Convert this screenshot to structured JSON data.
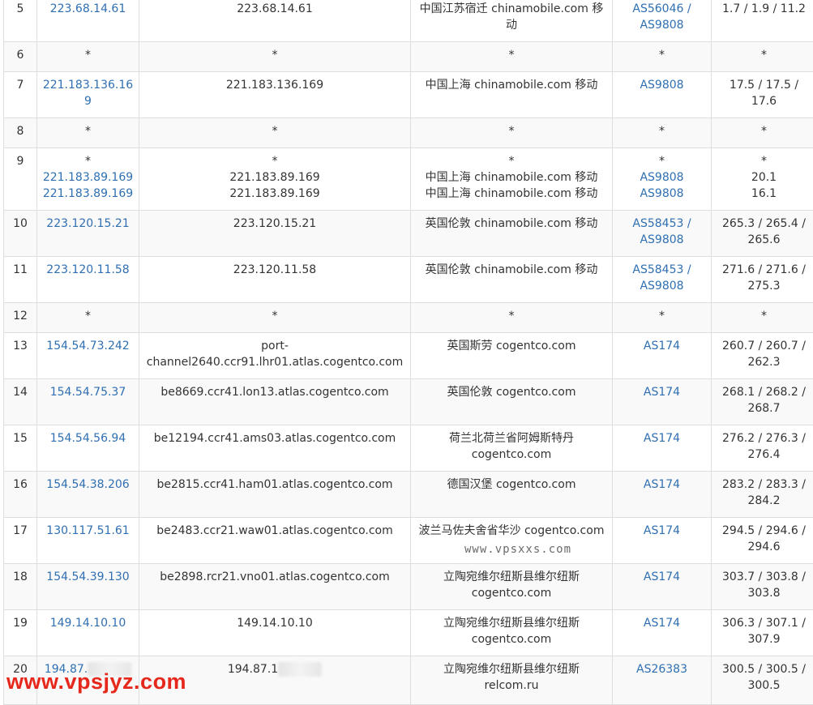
{
  "rows": [
    {
      "hop": "5",
      "ips": [
        "223.68.14.61"
      ],
      "hosts": [
        "223.68.14.61"
      ],
      "locations": [
        "中国江苏宿迁 chinamobile.com 移动"
      ],
      "as": [
        "AS56046 / AS9808"
      ],
      "times": [
        "1.7 / 1.9 / 11.2"
      ]
    },
    {
      "hop": "6",
      "ips": [
        "*"
      ],
      "hosts": [
        "*"
      ],
      "locations": [
        "*"
      ],
      "as": [
        "*"
      ],
      "times": [
        "*"
      ]
    },
    {
      "hop": "7",
      "ips": [
        "221.183.136.169"
      ],
      "hosts": [
        "221.183.136.169"
      ],
      "locations": [
        "中国上海 chinamobile.com 移动"
      ],
      "as": [
        "AS9808"
      ],
      "times": [
        "17.5 / 17.5 / 17.6"
      ]
    },
    {
      "hop": "8",
      "ips": [
        "*"
      ],
      "hosts": [
        "*"
      ],
      "locations": [
        "*"
      ],
      "as": [
        "*"
      ],
      "times": [
        "*"
      ]
    },
    {
      "hop": "9",
      "ips": [
        "*",
        "221.183.89.169",
        "221.183.89.169"
      ],
      "hosts": [
        "*",
        "221.183.89.169",
        "221.183.89.169"
      ],
      "locations": [
        "*",
        "中国上海 chinamobile.com 移动",
        "中国上海 chinamobile.com 移动"
      ],
      "as": [
        "*",
        "AS9808",
        "AS9808"
      ],
      "times": [
        "*",
        "20.1",
        "16.1"
      ]
    },
    {
      "hop": "10",
      "ips": [
        "223.120.15.21"
      ],
      "hosts": [
        "223.120.15.21"
      ],
      "locations": [
        "英国伦敦 chinamobile.com 移动"
      ],
      "as": [
        "AS58453 / AS9808"
      ],
      "times": [
        "265.3 / 265.4 / 265.6"
      ]
    },
    {
      "hop": "11",
      "ips": [
        "223.120.11.58"
      ],
      "hosts": [
        "223.120.11.58"
      ],
      "locations": [
        "英国伦敦 chinamobile.com 移动"
      ],
      "as": [
        "AS58453 / AS9808"
      ],
      "times": [
        "271.6 / 271.6 / 275.3"
      ]
    },
    {
      "hop": "12",
      "ips": [
        "*"
      ],
      "hosts": [
        "*"
      ],
      "locations": [
        "*"
      ],
      "as": [
        "*"
      ],
      "times": [
        "*"
      ]
    },
    {
      "hop": "13",
      "ips": [
        "154.54.73.242"
      ],
      "hosts": [
        "port-channel2640.ccr91.lhr01.atlas.cogentco.com"
      ],
      "locations": [
        "英国斯劳 cogentco.com"
      ],
      "as": [
        "AS174"
      ],
      "times": [
        "260.7 / 260.7 / 262.3"
      ]
    },
    {
      "hop": "14",
      "ips": [
        "154.54.75.37"
      ],
      "hosts": [
        "be8669.ccr41.lon13.atlas.cogentco.com"
      ],
      "locations": [
        "英国伦敦 cogentco.com"
      ],
      "as": [
        "AS174"
      ],
      "times": [
        "268.1 / 268.2 / 268.7"
      ]
    },
    {
      "hop": "15",
      "ips": [
        "154.54.56.94"
      ],
      "hosts": [
        "be12194.ccr41.ams03.atlas.cogentco.com"
      ],
      "locations": [
        "荷兰北荷兰省阿姆斯特丹 cogentco.com"
      ],
      "as": [
        "AS174"
      ],
      "times": [
        "276.2 / 276.3 / 276.4"
      ]
    },
    {
      "hop": "16",
      "ips": [
        "154.54.38.206"
      ],
      "hosts": [
        "be2815.ccr41.ham01.atlas.cogentco.com"
      ],
      "locations": [
        "德国汉堡 cogentco.com"
      ],
      "as": [
        "AS174"
      ],
      "times": [
        "283.2 / 283.3 / 284.2"
      ]
    },
    {
      "hop": "17",
      "ips": [
        "130.117.51.61"
      ],
      "hosts": [
        "be2483.ccr21.waw01.atlas.cogentco.com"
      ],
      "locations": [
        "波兰马佐夫舍省华沙 cogentco.com"
      ],
      "as": [
        "AS174"
      ],
      "times": [
        "294.5 / 294.6 / 294.6"
      ]
    },
    {
      "hop": "18",
      "ips": [
        "154.54.39.130"
      ],
      "hosts": [
        "be2898.rcr21.vno01.atlas.cogentco.com"
      ],
      "locations": [
        "立陶宛维尔纽斯县维尔纽斯 cogentco.com"
      ],
      "as": [
        "AS174"
      ],
      "times": [
        "303.7 / 303.8 / 303.8"
      ]
    },
    {
      "hop": "19",
      "ips": [
        "149.14.10.10"
      ],
      "hosts": [
        "149.14.10.10"
      ],
      "locations": [
        "立陶宛维尔纽斯县维尔纽斯 cogentco.com"
      ],
      "as": [
        "AS174"
      ],
      "times": [
        "306.3 / 307.1 / 307.9"
      ]
    },
    {
      "hop": "20",
      "ips": [
        "194.87."
      ],
      "hosts": [
        "194.87.1"
      ],
      "locations": [
        "立陶宛维尔纽斯县维尔纽斯 relcom.ru"
      ],
      "as": [
        "AS26383"
      ],
      "times": [
        "300.5 / 300.5 / 300.5"
      ],
      "redacted": true
    }
  ],
  "row_heights": [
    57,
    37,
    57,
    37,
    77,
    57,
    57,
    37,
    57,
    57,
    57,
    57,
    57,
    57,
    57,
    60
  ],
  "watermarks": {
    "table": "www.vpsxxs.com",
    "brand": "www.vpsjyz.com"
  },
  "colors": {
    "link": "#2f6fb2",
    "border": "#dedede",
    "stripe": "#f9f9f9",
    "brand": "#e6281c"
  }
}
